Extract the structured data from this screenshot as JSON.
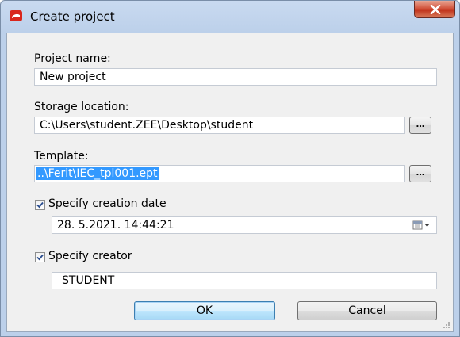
{
  "window": {
    "title": "Create project"
  },
  "form": {
    "project_name": {
      "label": "Project name:",
      "value": "New project"
    },
    "storage_location": {
      "label": "Storage location:",
      "value": "C:\\Users\\student.ZEE\\Desktop\\student",
      "browse_label": "..."
    },
    "template": {
      "label": "Template:",
      "value": "..\\Ferit\\IEC_tpl001.ept",
      "browse_label": "..."
    },
    "creation_date": {
      "checkbox_label": "Specify creation date",
      "checked": true,
      "value": "28.  5.2021. 14:44:21"
    },
    "creator": {
      "checkbox_label": "Specify creator",
      "checked": true,
      "value": "STUDENT"
    }
  },
  "buttons": {
    "ok_label": "OK",
    "cancel_label": "Cancel"
  },
  "colors": {
    "selection": "#3399ff",
    "close_button": "#c0311a",
    "frame": "#bcd0ea"
  },
  "icons": [
    "app-icon",
    "close-icon",
    "checkbox-check-icon",
    "calendar-dropdown-icon",
    "resize-grip-icon"
  ]
}
